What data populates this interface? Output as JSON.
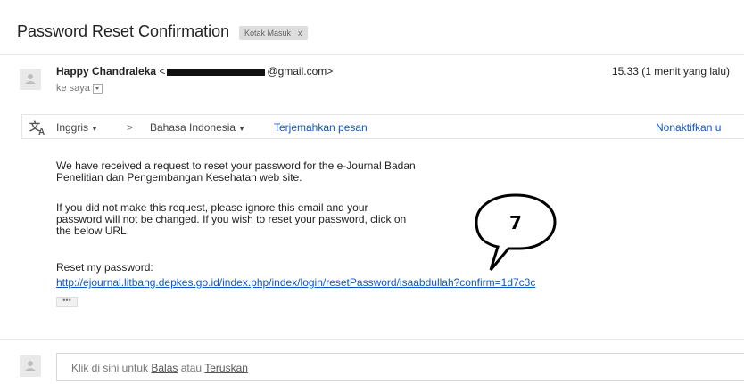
{
  "email": {
    "subject": "Password Reset Confirmation",
    "label_chip": "Kotak Masuk",
    "label_close": "x",
    "sender_name": "Happy Chandraleka",
    "sender_email_prefix": "<",
    "sender_email_suffix": "@gmail.com>",
    "to_me": "ke saya",
    "time": "15.33 (1 menit yang lalu)"
  },
  "translate": {
    "from_lang": "Inggris",
    "arrow": ">",
    "to_lang": "Bahasa Indonesia",
    "translate_link": "Terjemahkan pesan",
    "disable_link": "Nonaktifkan u"
  },
  "body": {
    "para1_line1": "We have received a request to reset your password for the e-Journal Badan",
    "para1_line2": "Penelitian dan Pengembangan Kesehatan web site.",
    "para2_line1": "If you did not make this request, please ignore this email and your",
    "para2_line2": "password will not be changed. If you wish to reset your password, click on",
    "para2_line3": "the below URL.",
    "reset_label": "Reset my password:",
    "reset_url": "http://ejournal.litbang.depkes.go.id/index.php/index/login/resetPassword/isaabdullah?confirm=1d7c3c",
    "ellipsis": "•••"
  },
  "reply": {
    "prefix": "Klik di sini untuk ",
    "reply_link": "Balas",
    "middle": " atau ",
    "forward_link": "Teruskan"
  },
  "annotation": {
    "number": "7"
  }
}
